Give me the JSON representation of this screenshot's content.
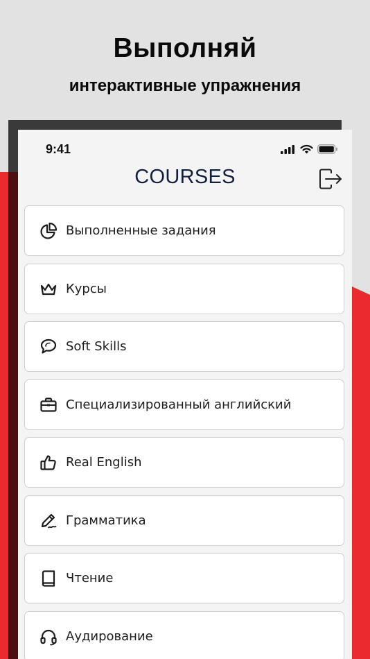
{
  "promo": {
    "title": "Выполняй",
    "subtitle": "интерактивные упражнения"
  },
  "status_bar": {
    "time": "9:41",
    "icons": [
      "signal-icon",
      "wifi-icon",
      "battery-icon"
    ]
  },
  "header": {
    "title": "COURSES",
    "logout_icon": "logout-icon"
  },
  "menu": {
    "items": [
      {
        "label": "Выполненные задания",
        "icon": "pie-chart-icon"
      },
      {
        "label": "Курсы",
        "icon": "crown-icon"
      },
      {
        "label": "Soft Skills",
        "icon": "chat-bubbles-icon"
      },
      {
        "label": "Специализированный английский",
        "icon": "briefcase-icon"
      },
      {
        "label": "Real English",
        "icon": "thumbs-up-icon"
      },
      {
        "label": "Грамматика",
        "icon": "pencil-icon"
      },
      {
        "label": "Чтение",
        "icon": "book-icon"
      },
      {
        "label": "Аудирование",
        "icon": "headphones-icon"
      }
    ]
  },
  "colors": {
    "background": "#e2e2e2",
    "accent_red": "#ea2a2f",
    "header_text": "#13203d",
    "card_border": "#cfcfd3"
  }
}
